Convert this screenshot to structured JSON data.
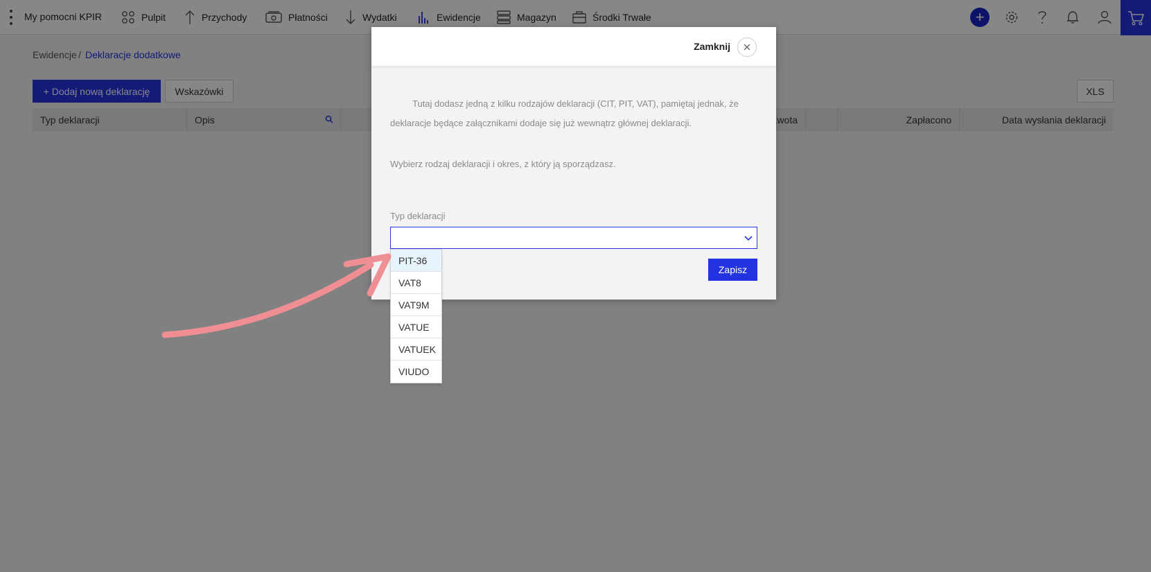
{
  "nav": {
    "brand": "My pomocni KPIR",
    "items": [
      {
        "label": "Pulpit",
        "icon": "grid-icon"
      },
      {
        "label": "Przychody",
        "icon": "arrow-up-icon"
      },
      {
        "label": "Płatności",
        "icon": "wallet-icon"
      },
      {
        "label": "Wydatki",
        "icon": "arrow-down-icon"
      },
      {
        "label": "Ewidencje",
        "icon": "bar-chart-icon"
      },
      {
        "label": "Magazyn",
        "icon": "stack-icon"
      },
      {
        "label": "Środki Trwałe",
        "icon": "briefcase-icon"
      }
    ],
    "accent": "#2433e0"
  },
  "breadcrumb": {
    "parent": "Ewidencje",
    "separator": "/",
    "current": "Deklaracje dodatkowe"
  },
  "toolbar": {
    "add_label": "+ Dodaj nową deklarację",
    "hints_label": "Wskazówki",
    "xls_label": "XLS"
  },
  "table": {
    "columns": [
      "Typ deklaracji",
      "Opis",
      "",
      "Kwota",
      "Zapłacono",
      "Data wysłania deklaracji"
    ]
  },
  "modal": {
    "close_label": "Zamknij",
    "paragraph1": "Tutaj dodasz jedną z kilku rodzajów deklaracji (CIT, PIT, VAT), pamiętaj jednak, że deklaracje będące załącznikami dodaje się już wewnątrz głównej deklaracji.",
    "paragraph2": "Wybierz rodzaj deklaracji i okres, z który ją sporządzasz.",
    "field_label": "Typ deklaracji",
    "select_value": "",
    "save_label": "Zapisz"
  },
  "dropdown": {
    "options": [
      "PIT-36",
      "VAT8",
      "VAT9M",
      "VATUE",
      "VATUEK",
      "VIUDO"
    ],
    "highlighted": "PIT-36"
  }
}
